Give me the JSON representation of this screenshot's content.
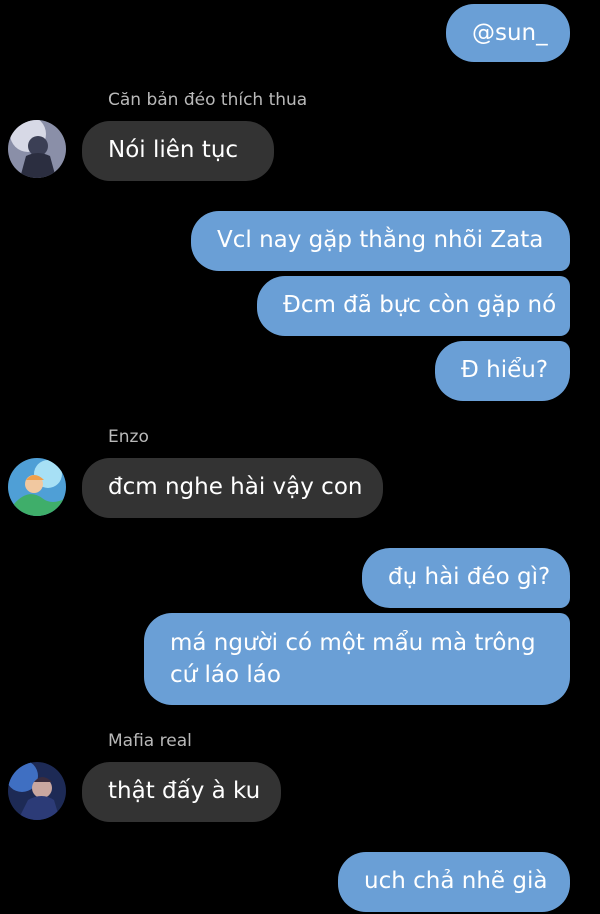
{
  "messages": {
    "m1": "@sun_",
    "m2_sender": "Căn bản đéo thích thua",
    "m2": "Nói liên tục",
    "m3": "Vcl nay gặp thằng nhõi Zata",
    "m4": "Đcm đã bực còn gặp nó",
    "m5": "Đ hiểu?",
    "m6_sender": "Enzo",
    "m6": "đcm nghe hài vậy con",
    "m7": "đụ hài đéo gì?",
    "m8_line1": "má người có một mẩu mà trông",
    "m8_line2": "cứ láo láo",
    "m9_sender": "Mafia real",
    "m9": "thật đấy à ku",
    "m10": "uch chả nhẽ già"
  },
  "colors": {
    "background": "#000000",
    "outgoing_bubble": "#6a9fd6",
    "incoming_bubble": "#333333",
    "sender_name": "#b9b9b9"
  },
  "icons": [
    "avatar-can-ban",
    "avatar-enzo",
    "avatar-mafia-real"
  ]
}
